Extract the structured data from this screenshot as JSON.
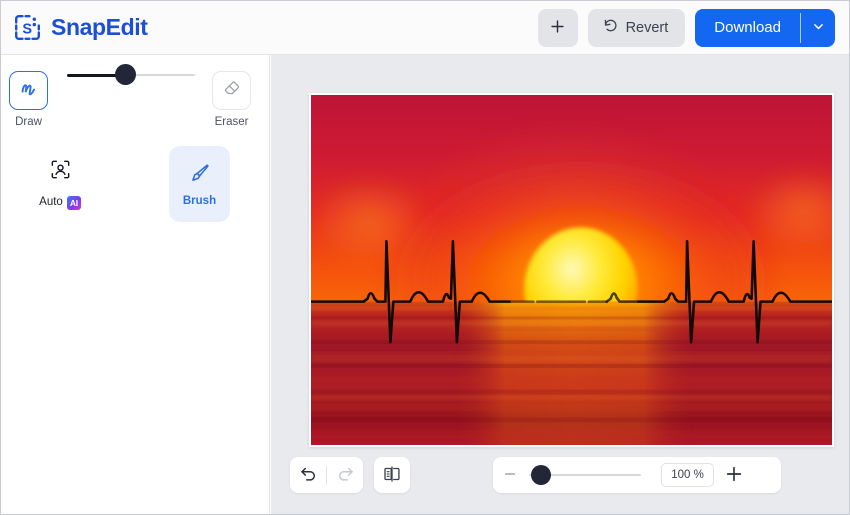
{
  "app": {
    "brand_name": "SnapEdit",
    "logo_icon": "snapedit-logo-icon"
  },
  "header": {
    "add_button": {
      "icon": "plus-icon",
      "label": "+"
    },
    "revert_button": {
      "icon": "revert-arrow-icon",
      "label": "Revert"
    },
    "download_button": {
      "label": "Download",
      "caret_icon": "chevron-down-icon"
    },
    "colors": {
      "accent": "#1367f0",
      "button_bg": "#e3e4e8",
      "header_bg": "#fbfbfc"
    }
  },
  "sidebar": {
    "draw_tool": {
      "label": "Draw",
      "icon": "draw-scribble-icon",
      "selected": true
    },
    "eraser_tool": {
      "label": "Eraser",
      "icon": "eraser-icon",
      "selected": false
    },
    "brush_size_slider": {
      "name": "brush-size-slider",
      "value": 40,
      "min": 0,
      "max": 100
    },
    "auto_tool": {
      "label": "Auto",
      "badge": "AI",
      "icon": "auto-face-scan-icon",
      "selected": false
    },
    "brush_tool": {
      "label": "Brush",
      "icon": "brush-icon",
      "selected": true
    },
    "colors": {
      "selected_border": "#2f6fe4",
      "selected_bg": "#e9f0fc",
      "ai_badge_gradient": "#7b3cf0"
    }
  },
  "canvas": {
    "artwork": {
      "name": "sunset-ecg-heartbeat-image",
      "description": "Red sunset over water with ECG heartbeat line across the horizon",
      "sky_color": "#c8152f",
      "sun_color": "#ffe01a",
      "glow_color": "#f4460f",
      "water_color": "#a81228",
      "line_color": "#120a06"
    },
    "background_color": "#e9eaee"
  },
  "bottombar": {
    "undo_button": {
      "label": "Undo",
      "icon": "undo-arrow-icon",
      "enabled": true
    },
    "redo_button": {
      "label": "Redo",
      "icon": "redo-arrow-icon",
      "enabled": false
    },
    "compare_button": {
      "label": "Compare",
      "icon": "compare-split-icon"
    },
    "zoom": {
      "minus_icon": "minus-icon",
      "plus_icon": "plus-icon",
      "value": "100 %",
      "slider_value": 3,
      "min": 0,
      "max": 100
    }
  }
}
